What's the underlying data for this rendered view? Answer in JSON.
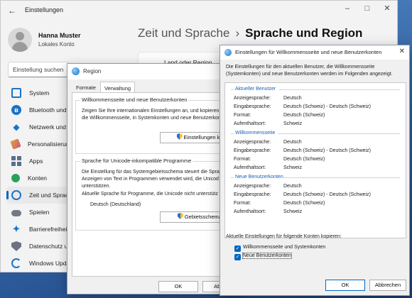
{
  "settings": {
    "title": "Einstellungen",
    "controls": {
      "minimize": "–",
      "maximize": "□",
      "close": "✕"
    },
    "user": {
      "name": "Hanna Muster",
      "account_type": "Lokales Konto"
    },
    "search_placeholder": "Einstellung suchen",
    "nav": [
      {
        "label": "System",
        "icon": "system-icon"
      },
      {
        "label": "Bluetooth und G",
        "icon": "bluetooth-icon"
      },
      {
        "label": "Netzwerk und In",
        "icon": "network-icon"
      },
      {
        "label": "Personalisierung",
        "icon": "personalization-icon"
      },
      {
        "label": "Apps",
        "icon": "apps-icon"
      },
      {
        "label": "Konten",
        "icon": "accounts-icon"
      },
      {
        "label": "Zeit und Sprach",
        "icon": "time-language-icon",
        "active": true
      },
      {
        "label": "Spielen",
        "icon": "gaming-icon"
      },
      {
        "label": "Barrierefreiheit",
        "icon": "accessibility-icon"
      },
      {
        "label": "Datenschutz und",
        "icon": "privacy-icon"
      },
      {
        "label": "Windows Upda",
        "icon": "windows-update-icon"
      }
    ],
    "breadcrumb": {
      "parent": "Zeit und Sprache",
      "separator": "›",
      "current": "Sprache und Region"
    },
    "land_card_label": "Land oder Region"
  },
  "region": {
    "title": "Region",
    "tabs": [
      {
        "label": "Formate"
      },
      {
        "label": "Verwaltung",
        "active": true
      }
    ],
    "welcome_group": {
      "title": "Willkommensseite und neue Benutzerkonten",
      "text": [
        "Zeigen Sie Ihre internationalen Einstellungen an, und kopieren",
        "die Willkommensseite, in Systemkonten und neue Benutzerkon"
      ],
      "button": "Einstellungen kopi"
    },
    "unicode_group": {
      "title": "Sprache für Unicode-inkompatible Programme",
      "text": [
        "Die Einstellung für das Systemgebietsschema steuert die Sprac",
        "Anzeigen von Text in Programmen verwendet wird, die Unicod",
        "unterstützen."
      ],
      "current_label": "Aktuelle Sprache für Programme, die Unicode nicht unterstütz",
      "current_value": "Deutsch (Deutschland)",
      "button": "Gebietsschema ä"
    },
    "ok": "OK",
    "cancel": "Abbrec"
  },
  "welcome": {
    "title": "Einstellungen für Willkommensseite und neue Benutzerkonten",
    "close": "✕",
    "intro": "Die Einstellungen für den aktuellen Benutzer, die Willkommensseite (Systemkonten) und neue Benutzerkonten werden im Folgenden angezeigt.",
    "sections": [
      {
        "title": "Aktueller Benutzer",
        "rows": [
          {
            "key": "Anzeigesprache:",
            "value": "Deutsch"
          },
          {
            "key": "Eingabesprache:",
            "value": "Deutsch (Schweiz) - Deutsch (Schweiz)"
          },
          {
            "key": "Format:",
            "value": "Deutsch (Schweiz)"
          },
          {
            "key": "Aufenthaltsort:",
            "value": "Schweiz"
          }
        ]
      },
      {
        "title": "Willkommensseite",
        "rows": [
          {
            "key": "Anzeigesprache:",
            "value": "Deutsch"
          },
          {
            "key": "Eingabesprache:",
            "value": "Deutsch (Schweiz) - Deutsch (Schweiz)"
          },
          {
            "key": "Format:",
            "value": "Deutsch (Schweiz)"
          },
          {
            "key": "Aufenthaltsort:",
            "value": "Schweiz"
          }
        ]
      },
      {
        "title": "Neue Benutzerkonten",
        "rows": [
          {
            "key": "Anzeigesprache:",
            "value": "Deutsch"
          },
          {
            "key": "Eingabesprache:",
            "value": "Deutsch (Schweiz) - Deutsch (Schweiz)"
          },
          {
            "key": "Format:",
            "value": "Deutsch (Schweiz)"
          },
          {
            "key": "Aufenthaltsort:",
            "value": "Schweiz"
          }
        ]
      }
    ],
    "copy_label": "Aktuelle Einstellungen für folgende Konten kopieren:",
    "checkboxes": [
      {
        "label": "Willkommensseite und Systemkonten",
        "checked": true
      },
      {
        "label": "Neue Benutzerkonten",
        "checked": true
      }
    ],
    "ok": "OK",
    "cancel": "Abbrechen"
  }
}
